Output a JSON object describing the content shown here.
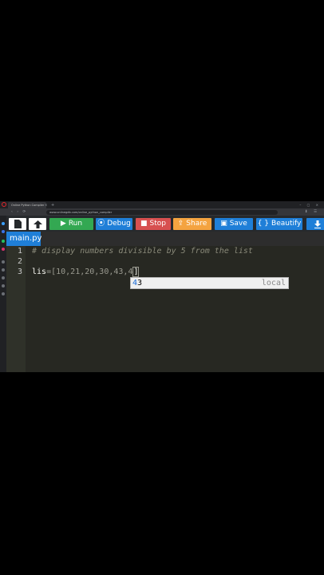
{
  "browser": {
    "tab_title": "Online Python Compiler",
    "tab_close": "×",
    "new_tab": "+",
    "url": "www.onlinegdb.com/online_python_compiler",
    "nav_glyphs": "‹ › ⟳",
    "window_controls": "– ▢ ×",
    "right_icons": "⬇ ☰"
  },
  "toolbar": {
    "run_label": "Run",
    "debug_label": "Debug",
    "stop_label": "Stop",
    "share_label": "Share",
    "save_label": "Save",
    "beautify_label": "Beautify"
  },
  "file_tab": {
    "name": "main.py"
  },
  "editor": {
    "line_numbers": [
      "1",
      "2",
      "3"
    ],
    "line1": "# display numbers divisible by 5 from the list",
    "line3_name": "lis",
    "line3_eq": "=",
    "line3_open": "[",
    "line3_values": "10,21,20,30,43,4",
    "line3_close": "]"
  },
  "autocomplete": {
    "typed": "4",
    "rest": "3",
    "kind": "local"
  },
  "colors": {
    "run": "#33a852",
    "debug": "#1f7fd8",
    "stop": "#d75050",
    "share": "#f4a340",
    "editor_bg": "#272822"
  }
}
